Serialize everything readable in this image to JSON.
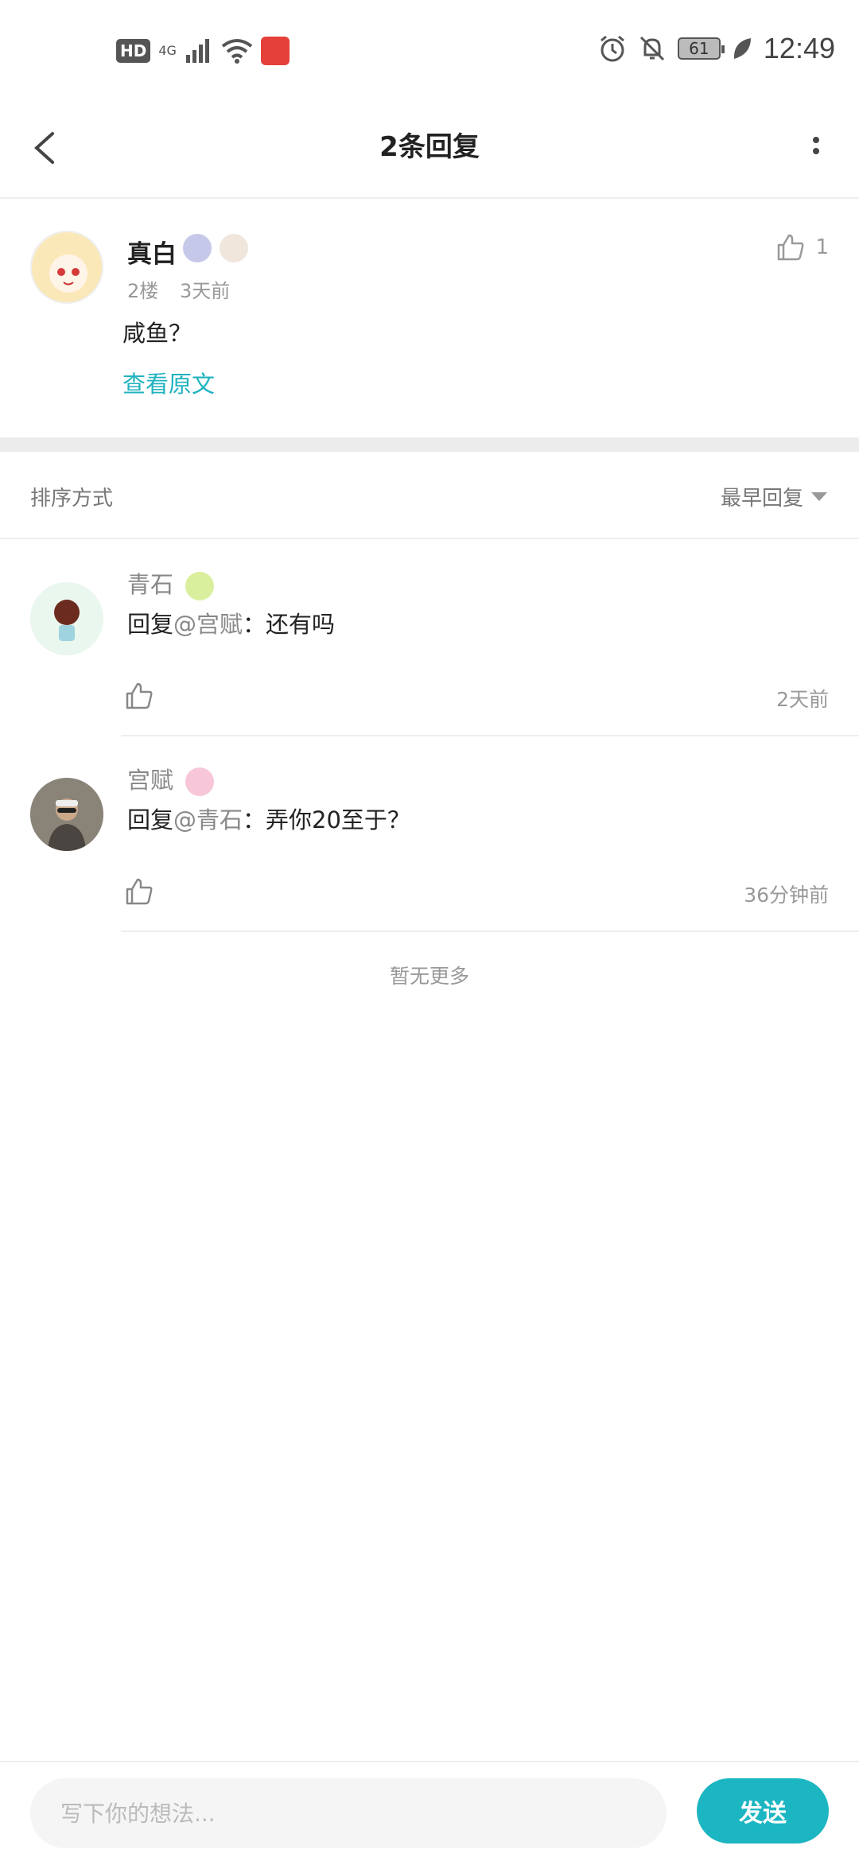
{
  "status_bar": {
    "hd": "HD",
    "network": "4G",
    "battery": "61",
    "time": "12:49"
  },
  "header": {
    "title": "2条回复"
  },
  "main_comment": {
    "username": "真白",
    "floor": "2楼",
    "time": "3天前",
    "content": "咸鱼？",
    "view_original": "查看原文",
    "likes": "1"
  },
  "sort": {
    "label": "排序方式",
    "selected": "最早回复"
  },
  "replies": [
    {
      "username": "青石",
      "prefix": "回复",
      "mention": "@宫赋",
      "text": "：还有吗",
      "time": "2天前"
    },
    {
      "username": "宫赋",
      "prefix": "回复",
      "mention": "@青石",
      "text": "：弄你20至于？",
      "time": "36分钟前"
    }
  ],
  "no_more": "暂无更多",
  "bottom": {
    "placeholder": "写下你的想法...",
    "send": "发送"
  },
  "colors": {
    "accent": "#1cb5c2",
    "link": "#1fb2bf",
    "muted": "#999999"
  }
}
